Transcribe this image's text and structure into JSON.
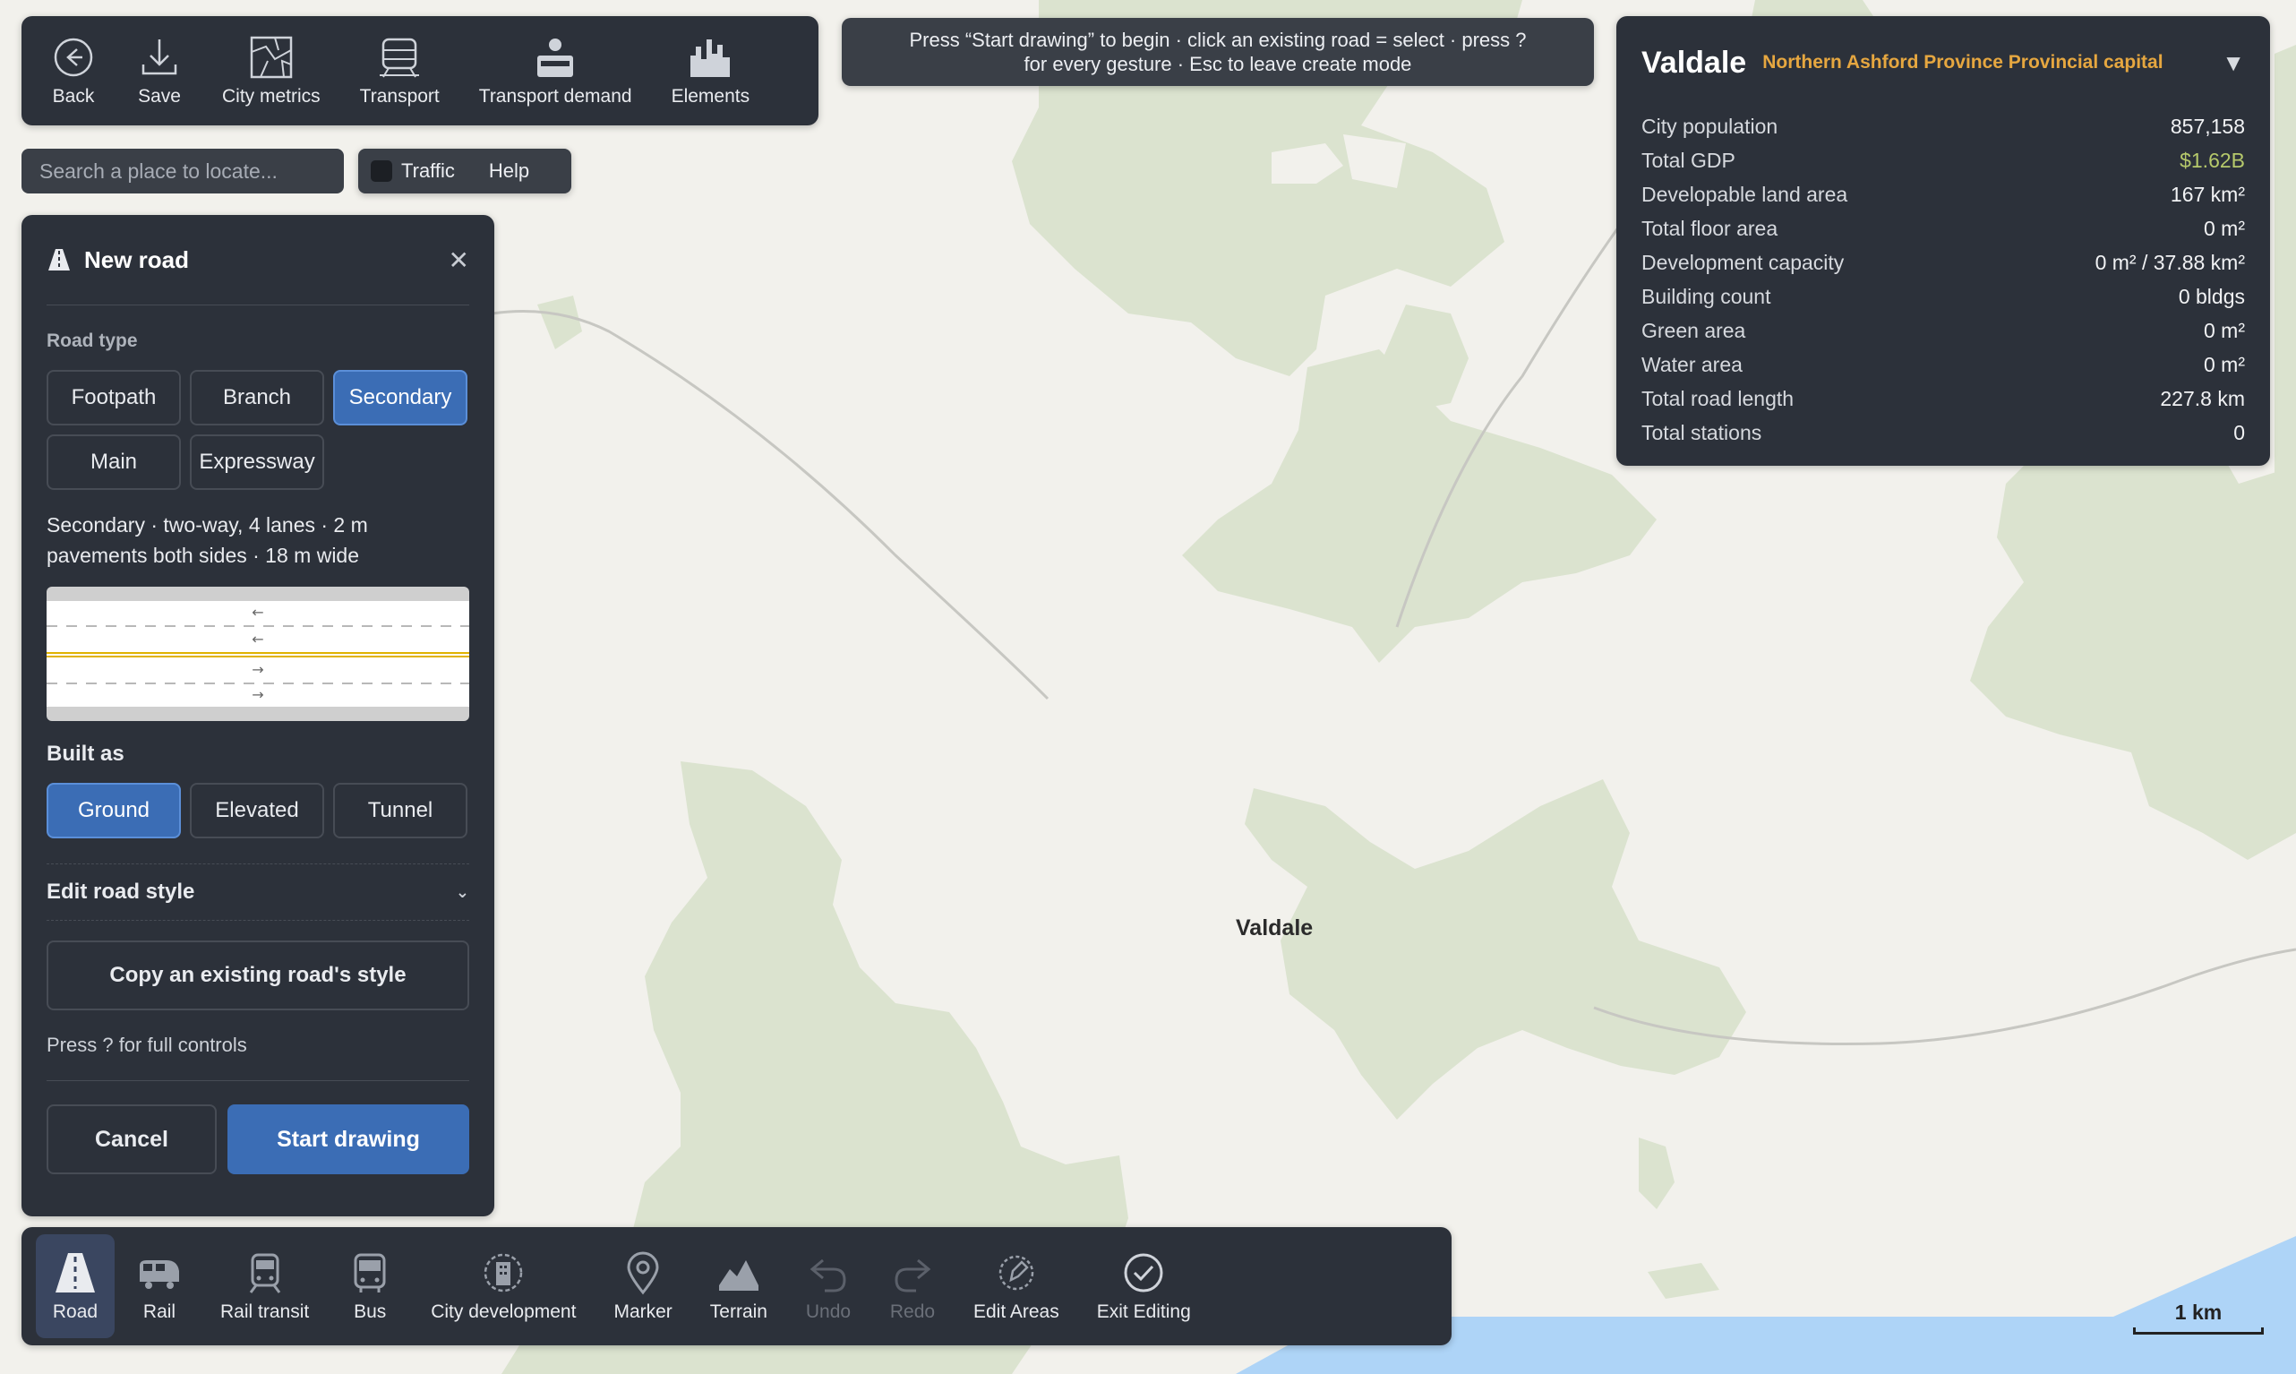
{
  "colors": {
    "panel_bg": "#2c313a",
    "accent_blue": "#3b6db5",
    "land_green": "#dbe3cf",
    "water_blue": "#aed4f7",
    "map_bg": "#f2f1ec",
    "province_orange": "#e6a740",
    "gdp_green": "#b6c96b"
  },
  "toolbar": {
    "items": [
      {
        "label": "Back",
        "icon": "back-circle-icon"
      },
      {
        "label": "Save",
        "icon": "download-icon"
      },
      {
        "label": "City metrics",
        "icon": "map-metrics-icon"
      },
      {
        "label": "Transport",
        "icon": "train-icon"
      },
      {
        "label": "Transport demand",
        "icon": "demand-icon"
      },
      {
        "label": "Elements",
        "icon": "city-elements-icon"
      }
    ]
  },
  "hint": {
    "line1": "Press “Start drawing” to begin · click an existing road = select · press ?",
    "line2": "for every gesture · Esc to leave create mode"
  },
  "search": {
    "placeholder": "Search a place to locate..."
  },
  "traffic": {
    "label": "Traffic",
    "checked": false
  },
  "help": {
    "label": "Help"
  },
  "road_panel": {
    "title": "New road",
    "road_type_title": "Road type",
    "road_types": [
      "Footpath",
      "Branch",
      "Secondary",
      "Main",
      "Expressway"
    ],
    "selected_type": "Secondary",
    "description_line1": "Secondary · two-way, 4 lanes · 2 m",
    "description_line2": "pavements both sides · 18 m wide",
    "built_as_title": "Built as",
    "built_as_options": [
      "Ground",
      "Elevated",
      "Tunnel"
    ],
    "selected_built_as": "Ground",
    "edit_style_label": "Edit road style",
    "copy_style_label": "Copy an existing road's style",
    "press_hint": "Press ? for full controls",
    "cancel_label": "Cancel",
    "start_label": "Start drawing"
  },
  "city": {
    "name": "Valdale",
    "subtitle": "Northern Ashford Province Provincial capital",
    "stats": [
      {
        "label": "City population",
        "value": "857,158"
      },
      {
        "label": "Total GDP",
        "value": "$1.62B"
      },
      {
        "label": "Developable land area",
        "value": "167 km²"
      },
      {
        "label": "Total floor area",
        "value": "0 m²"
      },
      {
        "label": "Development capacity",
        "value": "0 m² / 37.88 km²"
      },
      {
        "label": "Building count",
        "value": "0 bldgs"
      },
      {
        "label": "Green area",
        "value": "0 m²"
      },
      {
        "label": "Water area",
        "value": "0 m²"
      },
      {
        "label": "Total road length",
        "value": "227.8 km"
      },
      {
        "label": "Total stations",
        "value": "0"
      }
    ]
  },
  "bottom_bar": {
    "items": [
      {
        "label": "Road",
        "icon": "road-icon",
        "active": true,
        "disabled": false
      },
      {
        "label": "Rail",
        "icon": "rail-icon",
        "active": false,
        "disabled": false
      },
      {
        "label": "Rail transit",
        "icon": "rail-transit-icon",
        "active": false,
        "disabled": false
      },
      {
        "label": "Bus",
        "icon": "bus-icon",
        "active": false,
        "disabled": false
      },
      {
        "label": "City development",
        "icon": "city-development-icon",
        "active": false,
        "disabled": false
      },
      {
        "label": "Marker",
        "icon": "marker-icon",
        "active": false,
        "disabled": false
      },
      {
        "label": "Terrain",
        "icon": "terrain-icon",
        "active": false,
        "disabled": false
      },
      {
        "label": "Undo",
        "icon": "undo-icon",
        "active": false,
        "disabled": true
      },
      {
        "label": "Redo",
        "icon": "redo-icon",
        "active": false,
        "disabled": true
      },
      {
        "label": "Edit Areas",
        "icon": "edit-areas-icon",
        "active": false,
        "disabled": false
      },
      {
        "label": "Exit Editing",
        "icon": "check-circle-icon",
        "active": false,
        "disabled": false
      }
    ]
  },
  "map": {
    "city_label": "Valdale",
    "scale_label": "1 km"
  }
}
